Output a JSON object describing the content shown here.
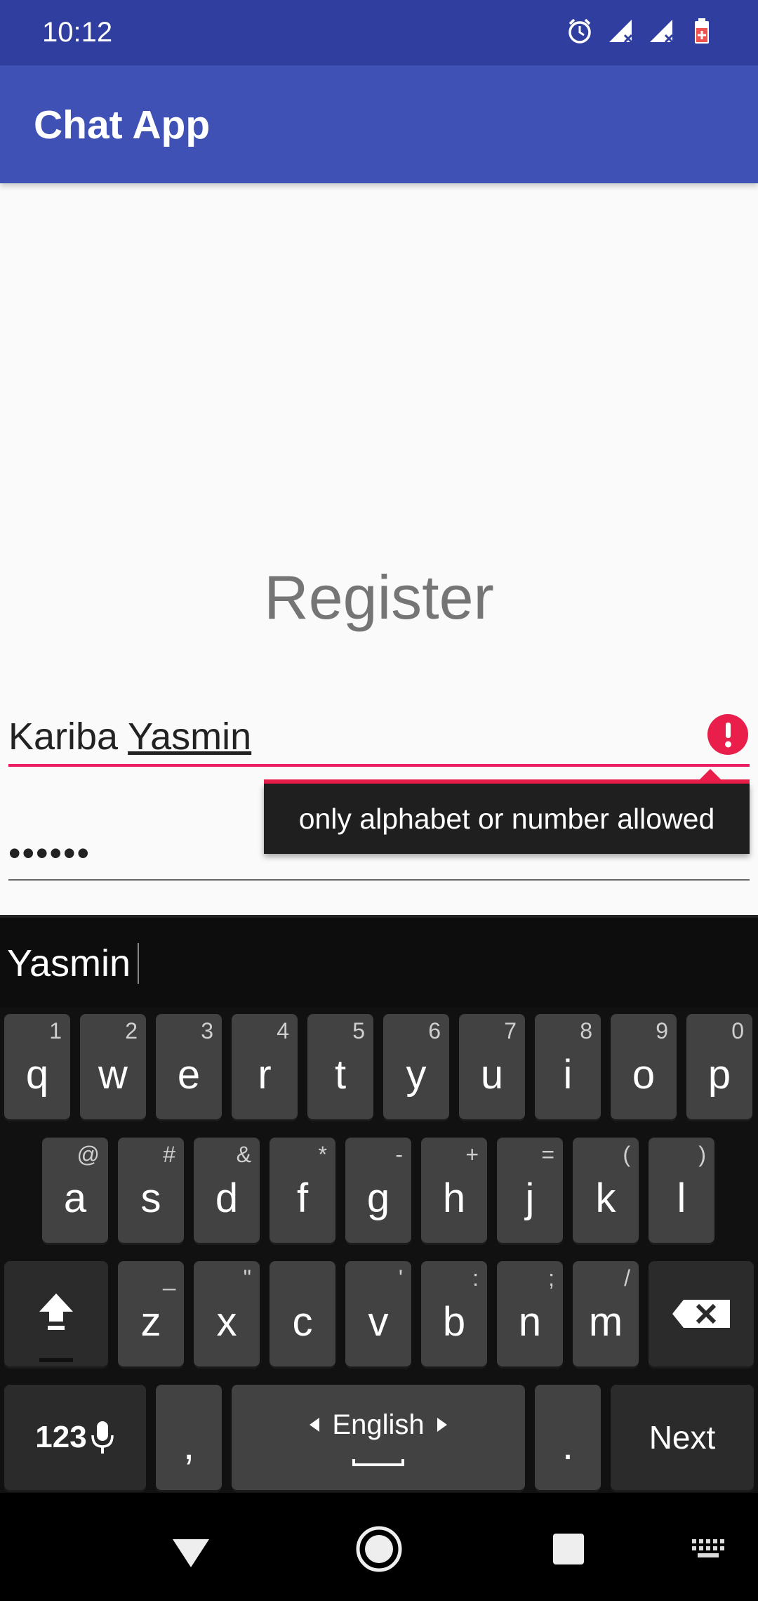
{
  "status_bar": {
    "time": "10:12"
  },
  "app_bar": {
    "title": "Chat App"
  },
  "form": {
    "heading": "Register",
    "name_field": {
      "value_prefix": "Kariba ",
      "value_word": "Yasmin"
    },
    "password_field": {
      "value": "••••••"
    },
    "error_message": "only alphabet or number allowed"
  },
  "keyboard": {
    "suggestion": "Yasmin",
    "row1": [
      {
        "main": "q",
        "hint": "1"
      },
      {
        "main": "w",
        "hint": "2"
      },
      {
        "main": "e",
        "hint": "3"
      },
      {
        "main": "r",
        "hint": "4"
      },
      {
        "main": "t",
        "hint": "5"
      },
      {
        "main": "y",
        "hint": "6"
      },
      {
        "main": "u",
        "hint": "7"
      },
      {
        "main": "i",
        "hint": "8"
      },
      {
        "main": "o",
        "hint": "9"
      },
      {
        "main": "p",
        "hint": "0"
      }
    ],
    "row2": [
      {
        "main": "a",
        "hint": "@"
      },
      {
        "main": "s",
        "hint": "#"
      },
      {
        "main": "d",
        "hint": "&"
      },
      {
        "main": "f",
        "hint": "*"
      },
      {
        "main": "g",
        "hint": "-"
      },
      {
        "main": "h",
        "hint": "+"
      },
      {
        "main": "j",
        "hint": "="
      },
      {
        "main": "k",
        "hint": "("
      },
      {
        "main": "l",
        "hint": ")"
      }
    ],
    "row3": [
      {
        "main": "z",
        "hint": "_"
      },
      {
        "main": "x",
        "hint": "\""
      },
      {
        "main": "c",
        "hint": ""
      },
      {
        "main": "v",
        "hint": "'"
      },
      {
        "main": "b",
        "hint": ":"
      },
      {
        "main": "n",
        "hint": ";"
      },
      {
        "main": "m",
        "hint": "/"
      }
    ],
    "symbols_label": "123",
    "comma": ",",
    "space_label": "English",
    "period": ".",
    "action_label": "Next"
  },
  "colors": {
    "primary": "#3f51b5",
    "primary_dark": "#303f9f",
    "error": "#e91e4a"
  }
}
